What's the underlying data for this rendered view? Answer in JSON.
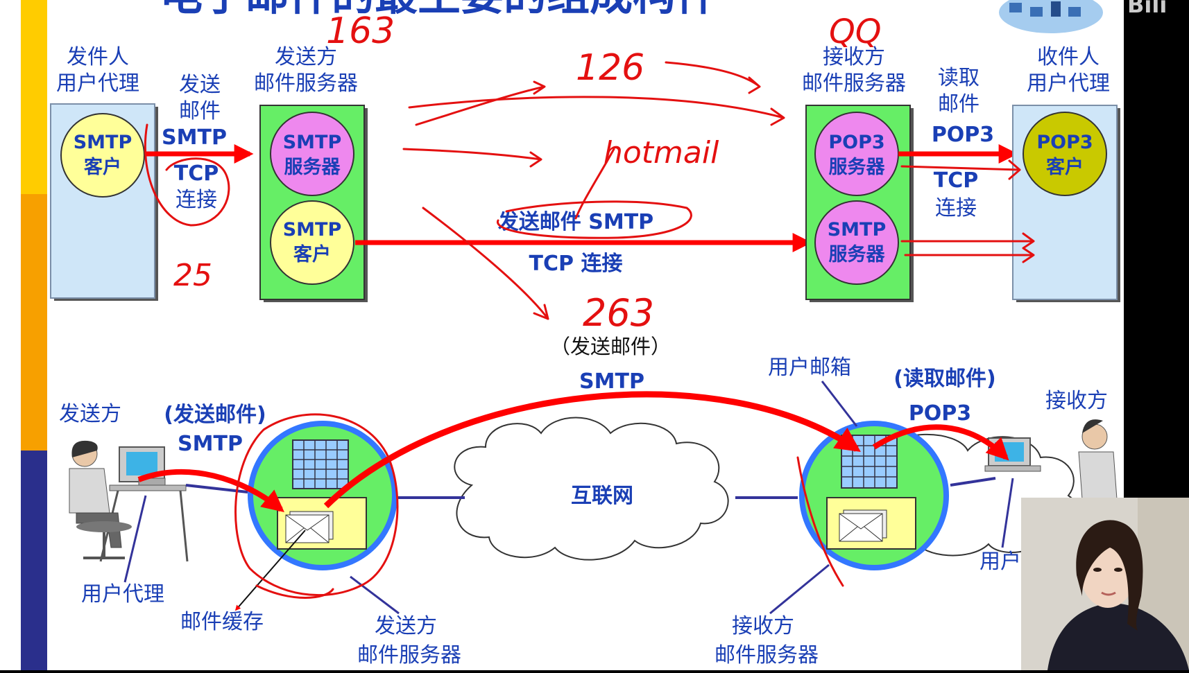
{
  "slide_title": "电子邮件的最主要的组成构件",
  "top": {
    "sender_agent": {
      "line1": "发件人",
      "line2": "用户代理",
      "inner1": "SMTP",
      "inner2": "客户"
    },
    "send_mail_label": {
      "line1": "发送",
      "line2": "邮件",
      "line3": "SMTP"
    },
    "tcp_left": {
      "line1": "TCP",
      "line2": "连接"
    },
    "sender_server": {
      "line1": "发送方",
      "line2": "邮件服务器",
      "a1": "SMTP",
      "a2": "服务器",
      "b1": "SMTP",
      "b2": "客户"
    },
    "mid_send_label": "发送邮件 SMTP",
    "mid_tcp_label": "TCP 连接",
    "receiver_server": {
      "line1": "接收方",
      "line2": "邮件服务器",
      "a1": "POP3",
      "a2": "服务器",
      "b1": "SMTP",
      "b2": "服务器"
    },
    "read_mail_label": {
      "line1": "读取",
      "line2": "邮件",
      "line3": "POP3"
    },
    "tcp_right": {
      "line1": "TCP",
      "line2": "连接"
    },
    "receiver_agent": {
      "line1": "收件人",
      "line2": "用户代理",
      "inner1": "POP3",
      "inner2": "客户"
    }
  },
  "bottom": {
    "sender": "发送方",
    "send_mail_paren": "(发送邮件)",
    "smtp_left": "SMTP",
    "send_mail_center": "（发送邮件）",
    "smtp_center": "SMTP",
    "mailbox": "用户邮箱",
    "read_mail_paren": "(读取邮件)",
    "pop3": "POP3",
    "receiver": "接收方",
    "internet": "互联网",
    "user_agent_left": "用户代理",
    "mail_cache": "邮件缓存",
    "sender_server": {
      "line1": "发送方",
      "line2": "邮件服务器"
    },
    "receiver_server": {
      "line1": "接收方",
      "line2": "邮件服务器"
    },
    "user_agent_right": "用户"
  },
  "handwriting": {
    "n163": "163",
    "qq": "QQ",
    "n126": "126",
    "hotmail": "hotmail",
    "n25": "25",
    "n263": "263"
  },
  "colors": {
    "slide_bg": "#ffffff",
    "left_bar_yellow": "#ffcc00",
    "left_bar_orange": "#f7a000",
    "left_bar_navy": "#2a2f8c",
    "agent_box": "#cfe6f8",
    "server_box": "#66ee66",
    "smtp_circle": "#ffff99",
    "server_circle": "#ee88ee",
    "pop3_client": "#c9c900",
    "label_blue": "#1a3fb5",
    "arrow_red": "#ff0000",
    "ink_red": "#e41010"
  }
}
